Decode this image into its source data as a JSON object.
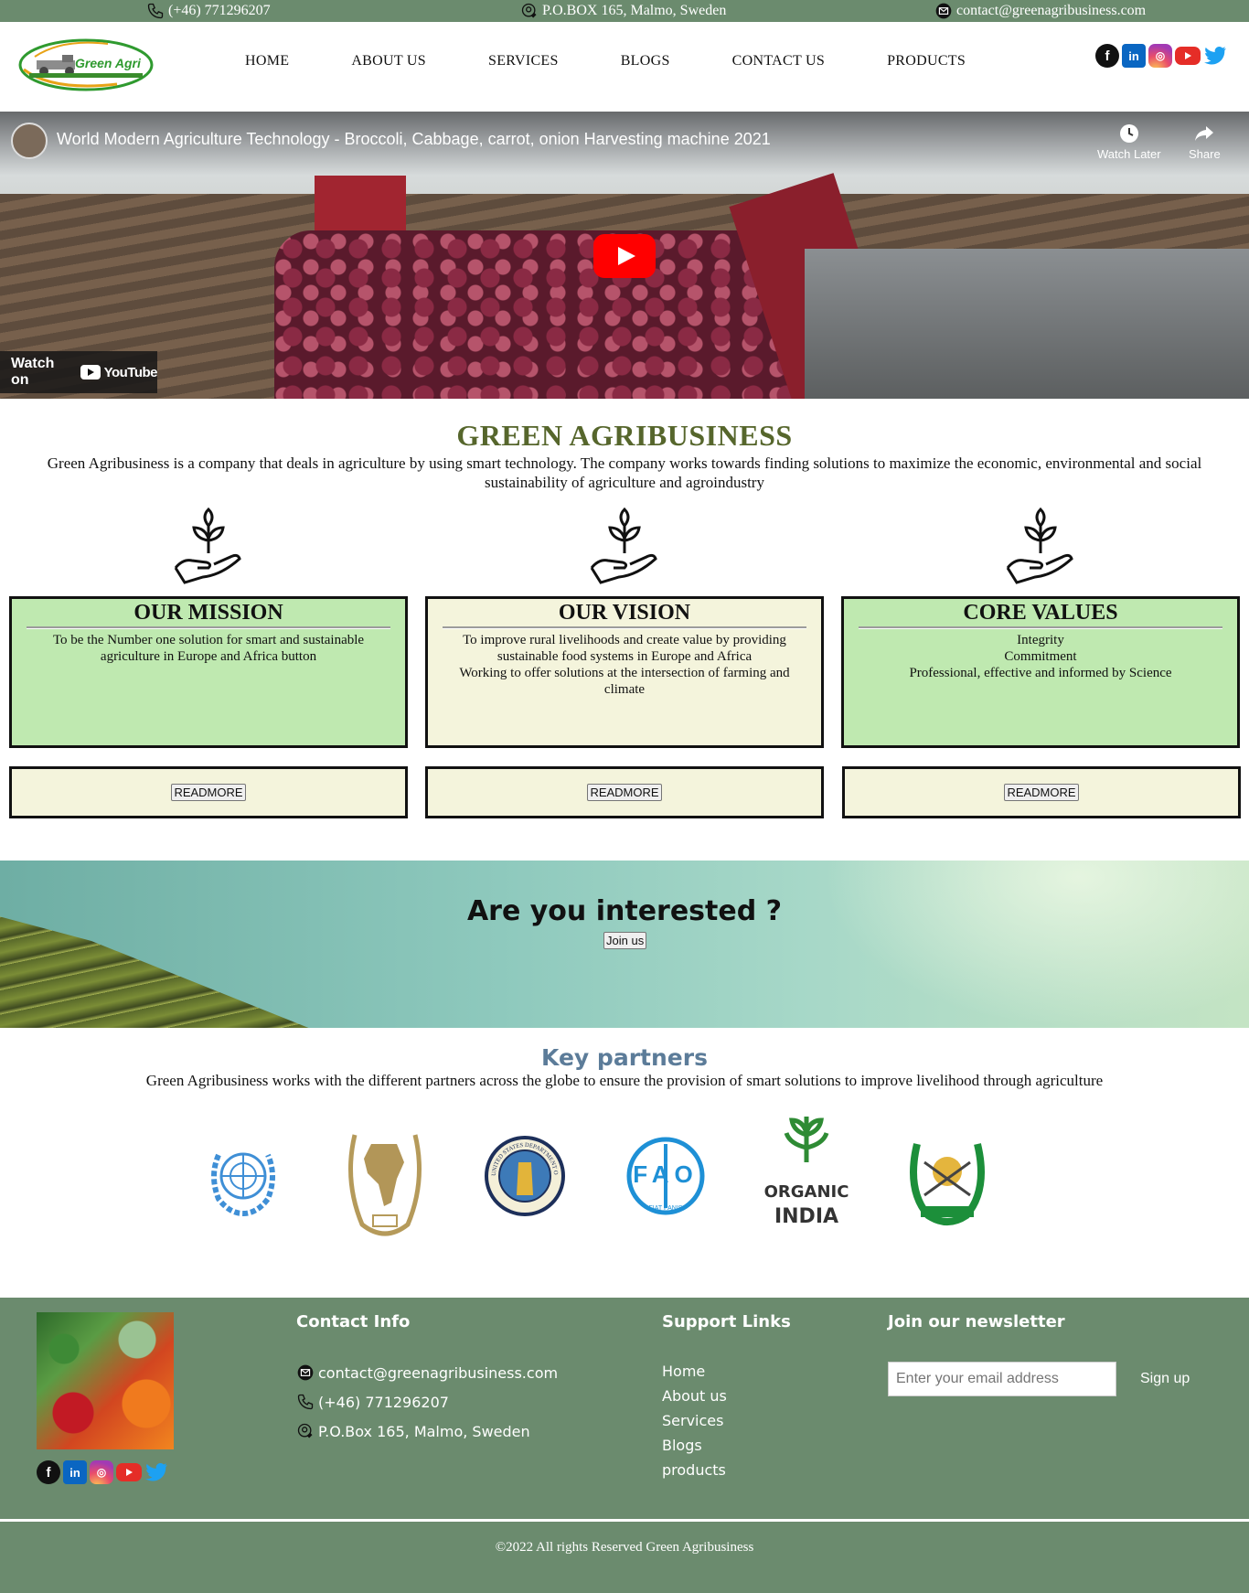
{
  "topbar": {
    "phone": "(+46) 771296207",
    "address": "P.O.BOX 165, Malmo, Sweden",
    "email": "contact@greenagribusiness.com"
  },
  "header": {
    "logo_text": "Green Agri",
    "nav": [
      "HOME",
      "ABOUT US",
      "SERVICES",
      "BLOGS",
      "CONTACT US",
      "PRODUCTS"
    ]
  },
  "video": {
    "title": "World Modern Agriculture Technology - Broccoli, Cabbage, carrot, onion Harvesting machine 2021",
    "watch_later": "Watch Later",
    "share": "Share",
    "watch_on": "Watch on",
    "youtube": "YouTube"
  },
  "intro": {
    "title": "GREEN AGRIBUSINESS",
    "text": "Green Agribusiness is a company that deals in agriculture by using smart technology. The company works towards finding solutions to maximize the economic, environmental and social sustainability of agriculture and agroindustry"
  },
  "cards": [
    {
      "title": "OUR MISSION",
      "lines": [
        "To be the Number one solution for smart and sustainable agriculture in Europe and Africa button"
      ]
    },
    {
      "title": "OUR VISION",
      "lines": [
        "To improve rural livelihoods and create value by providing sustainable food systems in Europe and Africa",
        "Working to offer solutions at the intersection of farming and climate"
      ]
    },
    {
      "title": "CORE VALUES",
      "lines": [
        "Integrity",
        "Commitment",
        "Professional, effective and informed by Science"
      ]
    }
  ],
  "readmore_label": "READMORE",
  "banner": {
    "question": "Are you interested ?",
    "join_label": "Join us"
  },
  "partners": {
    "title": "Key partners",
    "text": "Green Agribusiness works with the different partners across the globe to ensure the provision of smart solutions to improve livelihood through agriculture",
    "logos": [
      {
        "icon": "un-emblem-icon"
      },
      {
        "icon": "african-union-emblem-icon"
      },
      {
        "icon": "usda-seal-icon",
        "ring_text": "UNITED STATES DEPARTMENT OF AGRICULTURE"
      },
      {
        "icon": "fao-emblem-icon",
        "letters": "FAO",
        "motto": "FIAT PANIS"
      },
      {
        "icon": "organic-india-logo-icon",
        "line1": "ORGANIC",
        "line2": "INDIA"
      },
      {
        "icon": "emblem-icon"
      }
    ]
  },
  "footer": {
    "contact_title": "Contact Info",
    "email": "contact@greenagribusiness.com",
    "phone": "(+46) 771296207",
    "address": "P.O.Box 165, Malmo, Sweden",
    "support_title": "Support Links",
    "links": [
      "Home",
      "About us",
      "Services",
      "Blogs",
      "products"
    ],
    "newsletter_title": "Join our newsletter",
    "newsletter_placeholder": "Enter your email address",
    "signup_label": "Sign up",
    "copyright": "©2022 All rights Reserved Green Agribusiness"
  },
  "colors": {
    "bar_green": "#6b8b6e",
    "card_green": "#bfe9b0",
    "card_cream": "#f4f4dc",
    "title_olive": "#56662c",
    "partners_blue": "#5c7c99"
  }
}
